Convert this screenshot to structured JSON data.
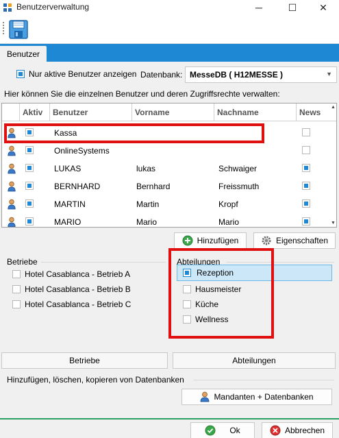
{
  "window": {
    "title": "Benutzerverwaltung",
    "minimize": "─",
    "maximize": "☐",
    "close": "✕"
  },
  "tabs": [
    {
      "label": "Benutzer"
    }
  ],
  "filter": {
    "active_only_label": "Nur aktive Benutzer anzeigen",
    "active_only_checked": true,
    "database_label": "Datenbank:",
    "database_value": "MesseDB  ( H12MESSE )"
  },
  "hint": "Hier können Sie die einzelnen Benutzer und deren Zugriffsrechte verwalten:",
  "users_table": {
    "columns": [
      "Aktiv",
      "Benutzer",
      "Vorname",
      "Nachname",
      "News"
    ],
    "rows": [
      {
        "aktiv": true,
        "benutzer": "Kassa",
        "vorname": "",
        "nachname": "",
        "news": false
      },
      {
        "aktiv": true,
        "benutzer": "OnlineSystems",
        "vorname": "",
        "nachname": "",
        "news": false
      },
      {
        "aktiv": true,
        "benutzer": "LUKAS",
        "vorname": "lukas",
        "nachname": "Schwaiger",
        "news": true
      },
      {
        "aktiv": true,
        "benutzer": "BERNHARD",
        "vorname": "Bernhard",
        "nachname": "Freissmuth",
        "news": true
      },
      {
        "aktiv": true,
        "benutzer": "MARTIN",
        "vorname": "Martin",
        "nachname": "Kropf",
        "news": true
      },
      {
        "aktiv": true,
        "benutzer": "MARIO",
        "vorname": "Mario",
        "nachname": "Mario",
        "news": true
      }
    ]
  },
  "actions": {
    "add_label": "Hinzufügen",
    "properties_label": "Eigenschaften"
  },
  "betriebe": {
    "title": "Betriebe",
    "items": [
      {
        "label": "Hotel Casablanca - Betrieb A",
        "checked": false
      },
      {
        "label": "Hotel Casablanca - Betrieb B",
        "checked": false
      },
      {
        "label": "Hotel Casablanca - Betrieb C",
        "checked": false
      }
    ],
    "button_label": "Betriebe"
  },
  "abteilungen": {
    "title": "Abteilungen",
    "items": [
      {
        "label": "Rezeption",
        "checked": true,
        "selected": true
      },
      {
        "label": "Hausmeister",
        "checked": false
      },
      {
        "label": "Küche",
        "checked": false
      },
      {
        "label": "Wellness",
        "checked": false
      }
    ],
    "button_label": "Abteilungen"
  },
  "databases_group": {
    "title": "Hinzufügen, löschen, kopieren von Datenbanken",
    "button_label": "Mandanten + Datenbanken"
  },
  "footer": {
    "ok_label": "Ok",
    "cancel_label": "Abbrechen"
  },
  "colors": {
    "accent": "#1e88d4",
    "highlight": "#e01010",
    "selection": "#cce8f8",
    "footer_line": "#2aa062"
  }
}
